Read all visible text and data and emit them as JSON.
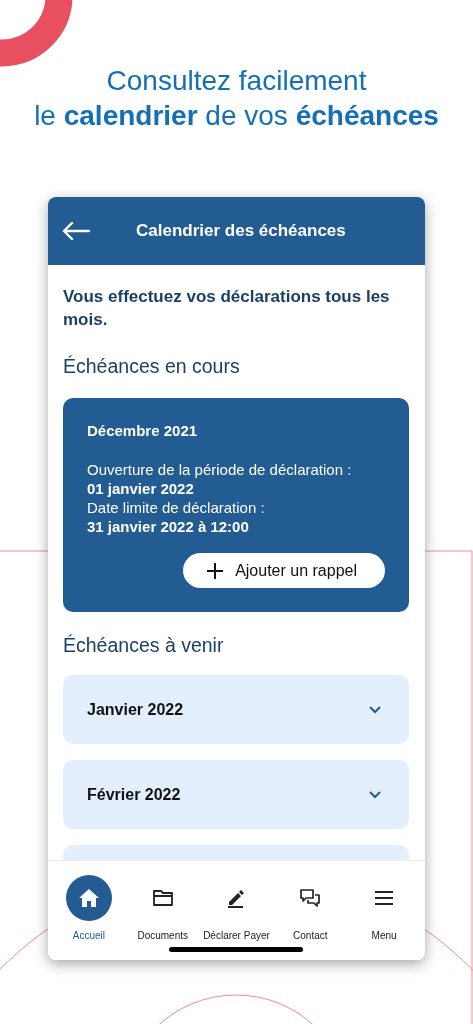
{
  "headline": {
    "line1": "Consultez facilement",
    "line2": "le **calendrier** de vos **échéances**"
  },
  "header": {
    "title": "Calendrier des échéances"
  },
  "intro": "Vous effectuez vos déclarations tous les mois.",
  "current": {
    "heading": "Échéances en cours",
    "card": {
      "month": "Décembre 2021",
      "lines": [
        {
          "kind": "label",
          "text": "Ouverture de la période de déclaration :"
        },
        {
          "kind": "value",
          "text": "01 janvier 2022"
        },
        {
          "kind": "label",
          "text": "Date limite de déclaration :"
        },
        {
          "kind": "value",
          "text": "31 janvier 2022 à 12:00"
        }
      ],
      "button": "Ajouter un rappel"
    }
  },
  "upcoming": {
    "heading": "Échéances à venir",
    "items": [
      {
        "month": "Janvier 2022",
        "expanded": false
      },
      {
        "month": "Février 2022",
        "expanded": false
      }
    ]
  },
  "nav": [
    {
      "kind": "home",
      "label": "Accueil",
      "selected": true
    },
    {
      "kind": "folder",
      "label": "Documents",
      "selected": false
    },
    {
      "kind": "pencil",
      "label": "Déclarer Payer",
      "selected": false
    },
    {
      "kind": "chat",
      "label": "Contact",
      "selected": false
    },
    {
      "kind": "menu",
      "label": "Menu",
      "selected": false
    }
  ]
}
